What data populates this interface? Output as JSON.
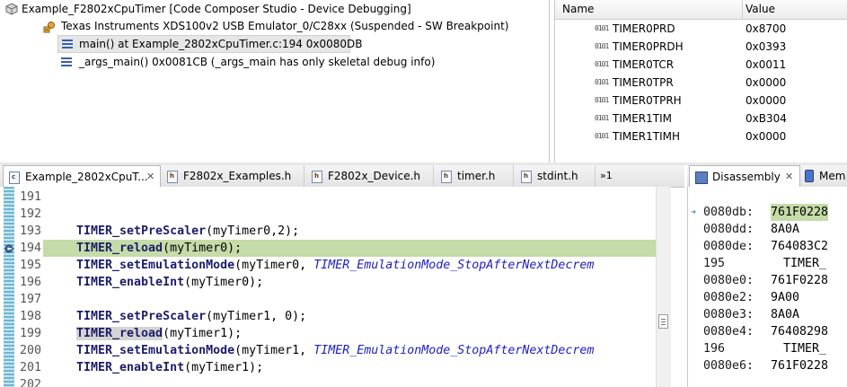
{
  "debug": {
    "root_label": "Example_F2802xCpuTimer [Code Composer Studio - Device Debugging]",
    "target_label": "Texas Instruments XDS100v2 USB Emulator_0/C28xx (Suspended - SW Breakpoint)",
    "frames": [
      "main() at Example_2802xCpuTimer.c:194 0x0080DB",
      "_args_main() 0x0081CB  (_args_main has only skeletal debug info)"
    ]
  },
  "registers": {
    "col_name": "Name",
    "col_value": "Value",
    "rows": [
      {
        "name": "TIMER0PRD",
        "value": "0x8700"
      },
      {
        "name": "TIMER0PRDH",
        "value": "0x0393"
      },
      {
        "name": "TIMER0TCR",
        "value": "0x0011"
      },
      {
        "name": "TIMER0TPR",
        "value": "0x0000"
      },
      {
        "name": "TIMER0TPRH",
        "value": "0x0000"
      },
      {
        "name": "TIMER1TIM",
        "value": "0xB304"
      },
      {
        "name": "TIMER1TIMH",
        "value": "0x0000"
      }
    ]
  },
  "editor": {
    "tabs": [
      "Example_2802xCpuT...",
      "F2802x_Examples.h",
      "F2802x_Device.h",
      "timer.h",
      "stdint.h"
    ],
    "overflow_label": "»1",
    "lines": [
      {
        "n": "191",
        "fn": "",
        "args": "",
        "enum": "",
        "tail": ""
      },
      {
        "n": "192",
        "fn": "",
        "args": "",
        "enum": "",
        "tail": ""
      },
      {
        "n": "193",
        "fn": "TIMER_setPreScaler",
        "args": "(myTimer0,2);",
        "enum": "",
        "tail": ""
      },
      {
        "n": "194",
        "fn": "TIMER_reload",
        "args": "(myTimer0);",
        "enum": "",
        "tail": ""
      },
      {
        "n": "195",
        "fn": "TIMER_setEmulationMode",
        "args": "(myTimer0, ",
        "enum": "TIMER_EmulationMode_StopAfterNextDecrem",
        "tail": ""
      },
      {
        "n": "196",
        "fn": "TIMER_enableInt",
        "args": "(myTimer0);",
        "enum": "",
        "tail": ""
      },
      {
        "n": "197",
        "fn": "",
        "args": "",
        "enum": "",
        "tail": ""
      },
      {
        "n": "198",
        "fn": "TIMER_setPreScaler",
        "args": "(myTimer1, 0);",
        "enum": "",
        "tail": ""
      },
      {
        "n": "199",
        "fn": "TIMER_reload",
        "args": "(myTimer1);",
        "enum": "",
        "tail": ""
      },
      {
        "n": "200",
        "fn": "TIMER_setEmulationMode",
        "args": "(myTimer1, ",
        "enum": "TIMER_EmulationMode_StopAfterNextDecrem",
        "tail": ""
      },
      {
        "n": "201",
        "fn": "TIMER_enableInt",
        "args": "(myTimer1);",
        "enum": "",
        "tail": ""
      },
      {
        "n": "202",
        "fn": "",
        "args": "",
        "enum": "",
        "tail": ""
      }
    ]
  },
  "disassembly": {
    "tab_label": "Disassembly",
    "tab2_label": "Mem",
    "rows": [
      {
        "addr": "",
        "op": ""
      },
      {
        "addr": "0080db:",
        "op": "761F0228"
      },
      {
        "addr": "0080dd:",
        "op": "8A0A"
      },
      {
        "addr": "0080de:",
        "op": "764083C2"
      },
      {
        "addr": "195",
        "op": "TIMER_"
      },
      {
        "addr": "0080e0:",
        "op": "761F0228"
      },
      {
        "addr": "0080e2:",
        "op": "9A00"
      },
      {
        "addr": "0080e3:",
        "op": "8A0A"
      },
      {
        "addr": "0080e4:",
        "op": "76408298"
      },
      {
        "addr": "196",
        "op": "TIMER_"
      },
      {
        "addr": "0080e6:",
        "op": "761F0228"
      }
    ]
  },
  "colors": {
    "current_line": "#c5dba8",
    "gutter": "#6fb6d2",
    "function": "#1d1d6b",
    "enum": "#2020c0"
  }
}
